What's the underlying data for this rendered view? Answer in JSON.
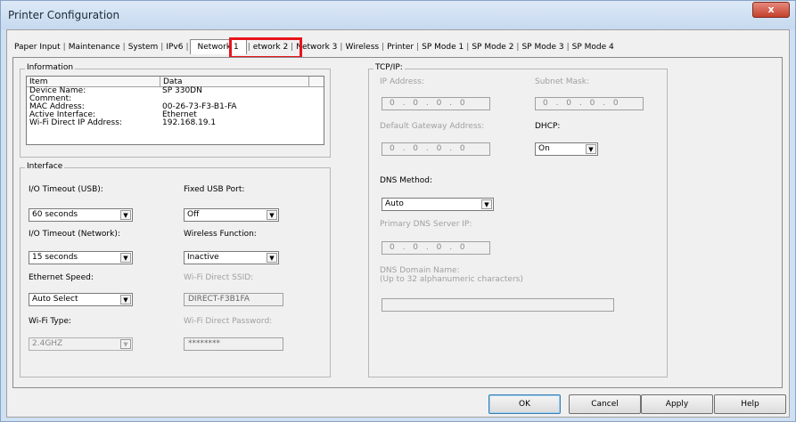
{
  "window": {
    "title": "Printer Configuration",
    "close_glyph": "x"
  },
  "tabs": [
    "Paper Input",
    "Maintenance",
    "System",
    "IPv6",
    "Network 1",
    "etwork 2",
    "Network 3",
    "Wireless",
    "Printer",
    "SP Mode 1",
    "SP Mode 2",
    "SP Mode 3",
    "SP Mode 4"
  ],
  "active_tab_index": 4,
  "tab_separator": "|",
  "information": {
    "legend": "Information",
    "columns": [
      "Item",
      "Data"
    ],
    "rows": [
      [
        "Device Name:",
        "SP 330DN"
      ],
      [
        "Comment:",
        ""
      ],
      [
        "MAC Address:",
        "00-26-73-F3-B1-FA"
      ],
      [
        "Active Interface:",
        "Ethernet"
      ],
      [
        "Wi-Fi Direct IP Address:",
        "192.168.19.1"
      ]
    ]
  },
  "interface": {
    "legend": "Interface",
    "io_timeout_usb": {
      "label": "I/O Timeout (USB):",
      "value": "60 seconds"
    },
    "fixed_usb_port": {
      "label": "Fixed USB Port:",
      "value": "Off"
    },
    "io_timeout_network": {
      "label": "I/O Timeout (Network):",
      "value": "15 seconds"
    },
    "wireless_function": {
      "label": "Wireless Function:",
      "value": "Inactive"
    },
    "ethernet_speed": {
      "label": "Ethernet Speed:",
      "value": "Auto Select"
    },
    "wifi_direct_ssid": {
      "label": "Wi-Fi Direct SSID:",
      "value": "DIRECT-F3B1FA"
    },
    "wifi_type": {
      "label": "Wi-Fi Type:",
      "value": "2.4GHZ"
    },
    "wifi_direct_password": {
      "label": "Wi-Fi Direct Password:",
      "value": "********"
    }
  },
  "tcpip": {
    "legend": "TCP/IP:",
    "ip_address": {
      "label": "IP Address:",
      "value": "0 . 0 . 0 . 0"
    },
    "subnet_mask": {
      "label": "Subnet Mask:",
      "value": "0 . 0 . 0 . 0"
    },
    "default_gateway": {
      "label": "Default Gateway Address:",
      "value": "0 . 0 . 0 . 0"
    },
    "dhcp": {
      "label": "DHCP:",
      "value": "On"
    },
    "dns_method": {
      "label": "DNS Method:",
      "value": "Auto"
    },
    "primary_dns": {
      "label": "Primary DNS Server IP:",
      "value": "0 . 0 . 0 . 0"
    },
    "dns_domain": {
      "label_line1": "DNS Domain Name:",
      "label_line2": "(Up to 32 alphanumeric characters)",
      "value": ""
    }
  },
  "buttons": {
    "ok": "OK",
    "cancel": "Cancel",
    "apply": "Apply",
    "help": "Help"
  },
  "combo_arrow": "▼"
}
